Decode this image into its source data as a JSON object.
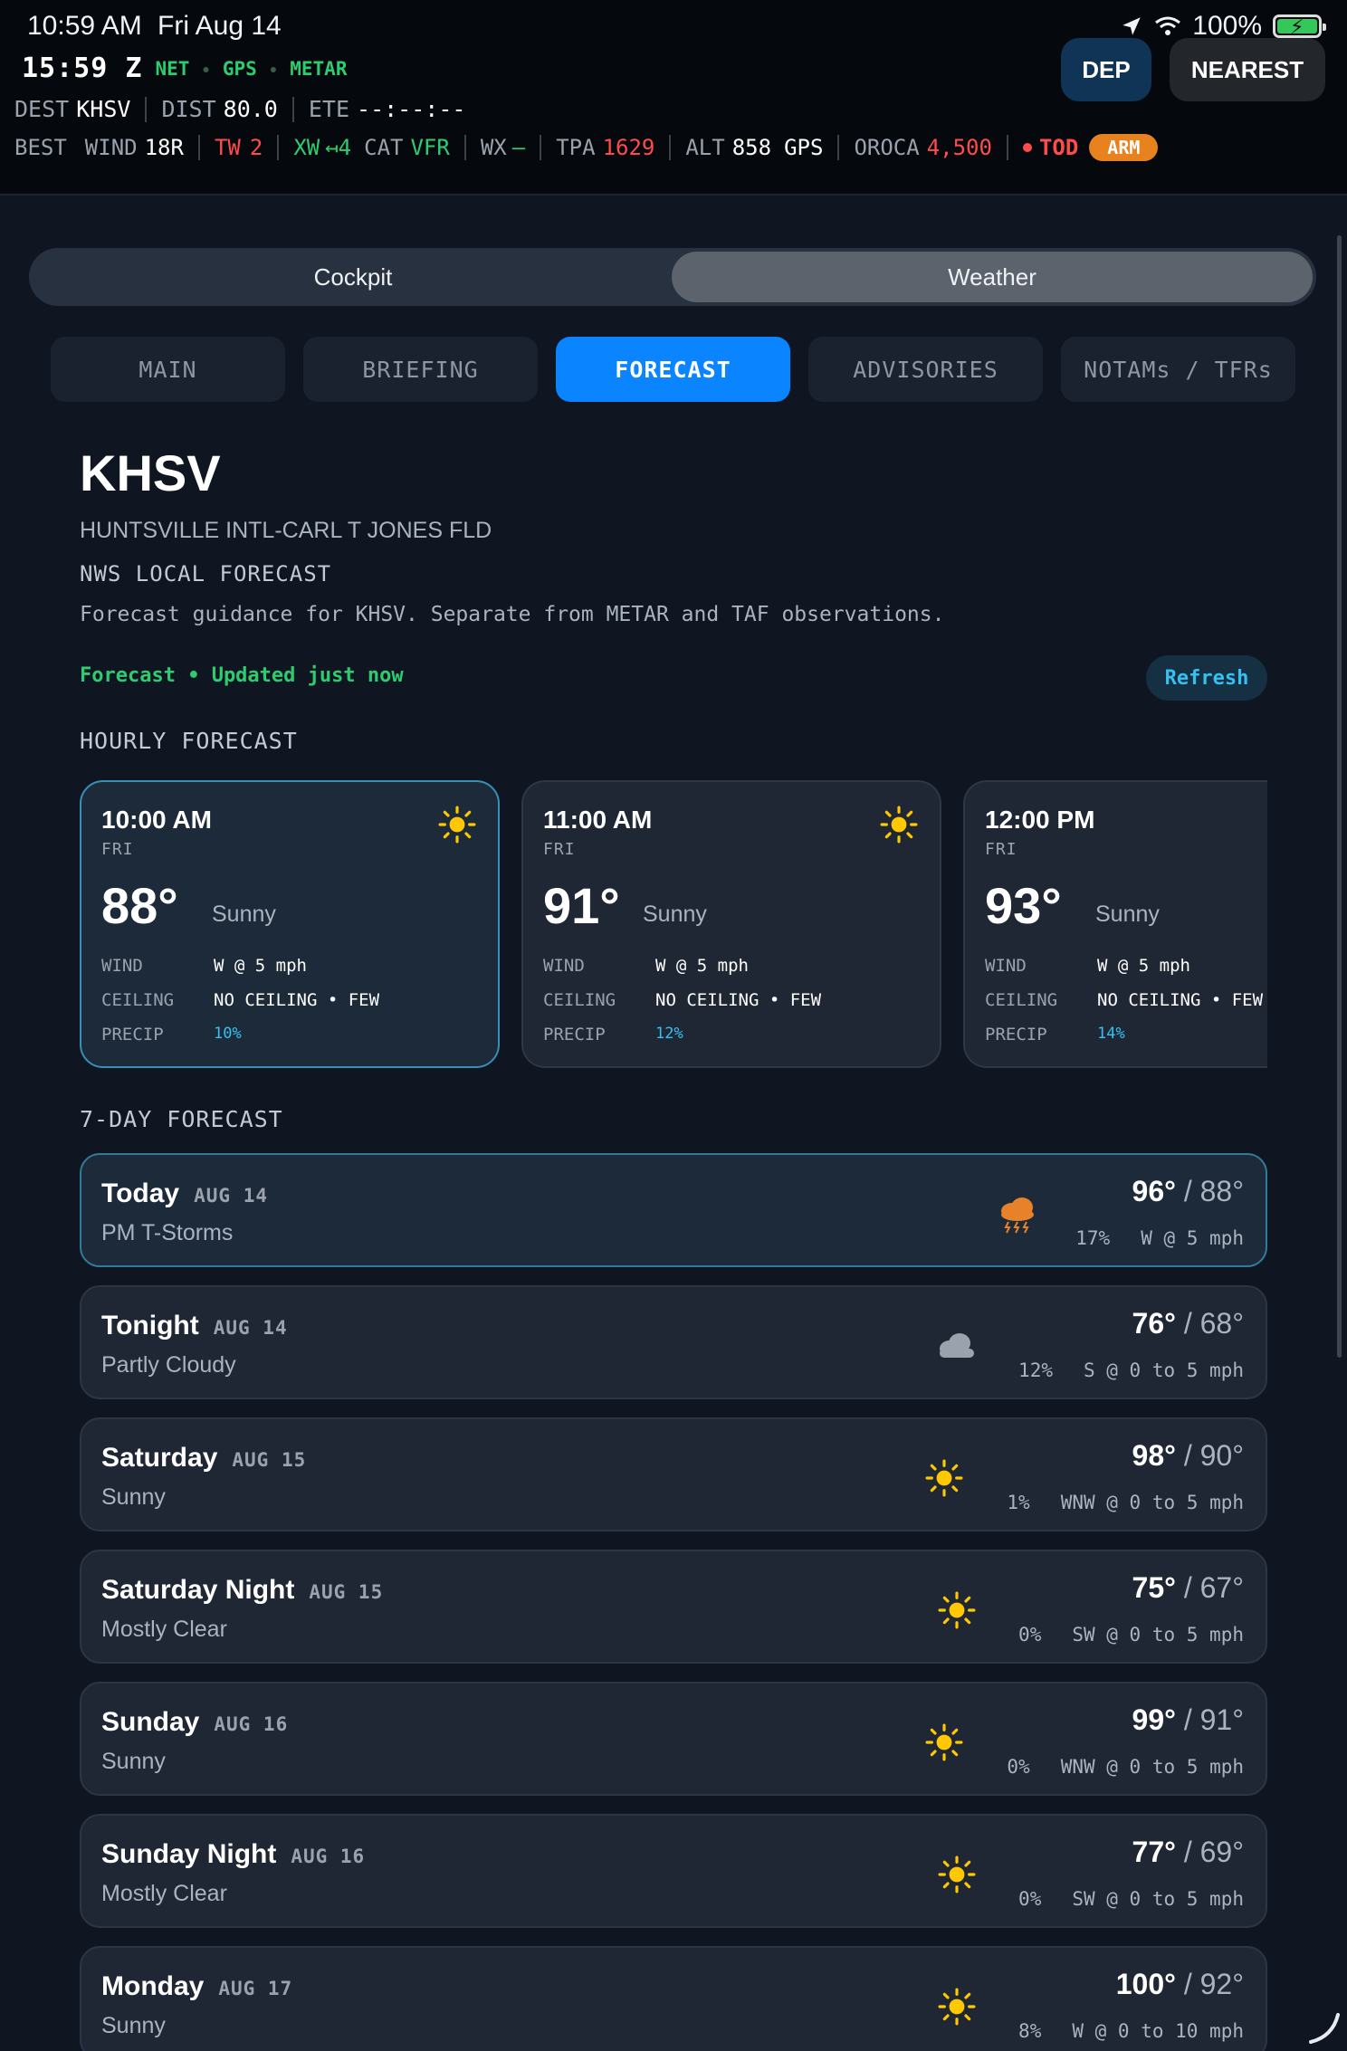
{
  "status_bar": {
    "time": "10:59 AM",
    "date": "Fri Aug 14",
    "battery": "100%",
    "icons": [
      "location-arrow-icon",
      "wifi-icon",
      "battery-charging-icon"
    ]
  },
  "header": {
    "zulu": "15:59 Z",
    "sources": [
      "NET",
      "GPS",
      "METAR"
    ],
    "dep_label": "DEP",
    "nearest_label": "NEAREST",
    "dest_label": "DEST",
    "dest_value": "KHSV",
    "dist_label": "DIST",
    "dist_value": "80.0",
    "ete_label": "ETE",
    "ete_value": "--:--:--",
    "best_label": "BEST",
    "wind_label": "WIND",
    "wind_value": "18R",
    "tw_label": "TW",
    "tw_value": "2",
    "xw_label": "XW",
    "xw_value": "↤4",
    "cat_label": "CAT",
    "cat_value": "VFR",
    "wx_label": "WX",
    "wx_value": "—",
    "tpa_label": "TPA",
    "tpa_value": "1629",
    "alt_label": "ALT",
    "alt_value": "858",
    "alt_src": "GPS",
    "oroca_label": "OROCA",
    "oroca_value": "4,500",
    "tod_label": "TOD",
    "arm_label": "ARM"
  },
  "segment": {
    "cockpit": "Cockpit",
    "weather": "Weather",
    "active": "weather"
  },
  "tabs": [
    {
      "label": "MAIN"
    },
    {
      "label": "BRIEFING"
    },
    {
      "label": "FORECAST",
      "active": true
    },
    {
      "label": "ADVISORIES"
    },
    {
      "label": "NOTAMs / TFRs"
    }
  ],
  "station": {
    "id": "KHSV",
    "name": "HUNTSVILLE INTL-CARL T JONES FLD",
    "section": "NWS LOCAL FORECAST",
    "guidance": "Forecast guidance for KHSV. Separate from METAR and TAF observations.",
    "status": "Forecast • Updated just now",
    "refresh_label": "Refresh"
  },
  "hourly": {
    "title": "HOURLY FORECAST",
    "labels": {
      "wind": "WIND",
      "ceiling": "CEILING",
      "precip": "PRECIP"
    },
    "items": [
      {
        "time": "10:00 AM",
        "day": "FRI",
        "temp": "88°",
        "cond": "Sunny",
        "wind": "W @ 5 mph",
        "ceiling": "NO CEILING • FEW",
        "precip": "10%",
        "icon": "sun-icon"
      },
      {
        "time": "11:00 AM",
        "day": "FRI",
        "temp": "91°",
        "cond": "Sunny",
        "wind": "W @ 5 mph",
        "ceiling": "NO CEILING • FEW",
        "precip": "12%",
        "icon": "sun-icon"
      },
      {
        "time": "12:00 PM",
        "day": "FRI",
        "temp": "93°",
        "cond": "Sunny",
        "wind": "W @ 5 mph",
        "ceiling": "NO CEILING • FEW",
        "precip": "14%",
        "icon": "sun-icon"
      }
    ]
  },
  "daily": {
    "title": "7-DAY FORECAST",
    "items": [
      {
        "name": "Today",
        "date": "AUG 14",
        "cond": "PM T-Storms",
        "hi": "96°",
        "lo": "/ 88°",
        "precip": "17%",
        "wind": "W @ 5 mph",
        "icon": "thunderstorm-icon"
      },
      {
        "name": "Tonight",
        "date": "AUG 14",
        "cond": "Partly Cloudy",
        "hi": "76°",
        "lo": "/ 68°",
        "precip": "12%",
        "wind": "S @ 0 to 5 mph",
        "icon": "cloud-icon"
      },
      {
        "name": "Saturday",
        "date": "AUG 15",
        "cond": "Sunny",
        "hi": "98°",
        "lo": "/ 90°",
        "precip": "1%",
        "wind": "WNW @ 0 to 5 mph",
        "icon": "sun-icon"
      },
      {
        "name": "Saturday Night",
        "date": "AUG 15",
        "cond": "Mostly Clear",
        "hi": "75°",
        "lo": "/ 67°",
        "precip": "0%",
        "wind": "SW @ 0 to 5 mph",
        "icon": "sun-icon"
      },
      {
        "name": "Sunday",
        "date": "AUG 16",
        "cond": "Sunny",
        "hi": "99°",
        "lo": "/ 91°",
        "precip": "0%",
        "wind": "WNW @ 0 to 5 mph",
        "icon": "sun-icon"
      },
      {
        "name": "Sunday Night",
        "date": "AUG 16",
        "cond": "Mostly Clear",
        "hi": "77°",
        "lo": "/ 69°",
        "precip": "0%",
        "wind": "SW @ 0 to 5 mph",
        "icon": "sun-icon"
      },
      {
        "name": "Monday",
        "date": "AUG 17",
        "cond": "Sunny",
        "hi": "100°",
        "lo": "/ 92°",
        "precip": "8%",
        "wind": "W @ 0 to 10 mph",
        "icon": "sun-icon"
      }
    ]
  },
  "colors": {
    "accent": "#0a84ff",
    "green": "#2ecc71",
    "red": "#ff4b4b",
    "arm": "#e8821e",
    "sun": "#ffc800",
    "storm": "#e8822a"
  }
}
